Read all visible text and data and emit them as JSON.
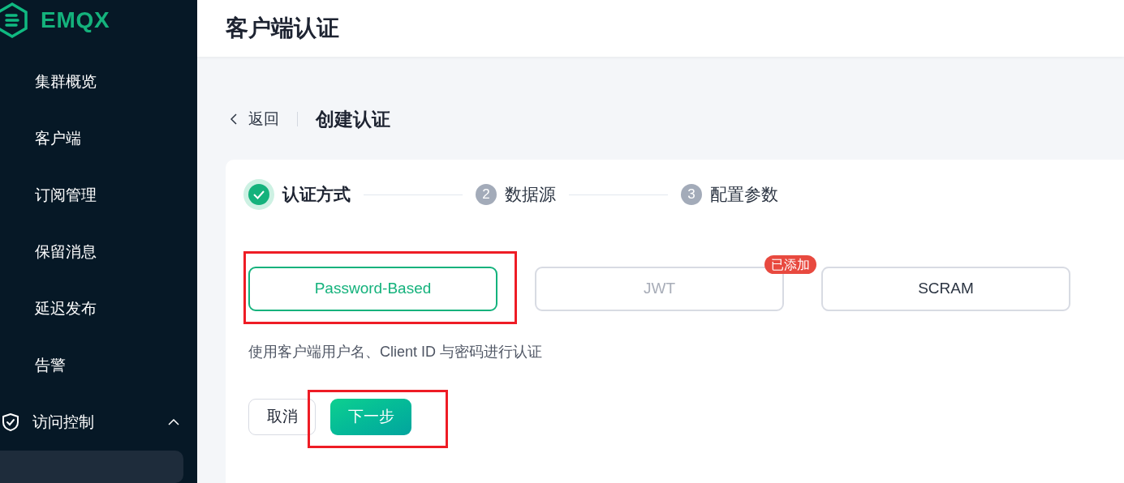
{
  "brand": {
    "name": "EMQX"
  },
  "sidebar": {
    "items": [
      {
        "label": "集群概览",
        "selected": false
      },
      {
        "label": "客户端",
        "selected": false
      },
      {
        "label": "订阅管理",
        "selected": false
      },
      {
        "label": "保留消息",
        "selected": false
      },
      {
        "label": "延迟发布",
        "selected": false
      },
      {
        "label": "告警",
        "selected": false
      },
      {
        "label": "访问控制",
        "selected": false,
        "expanded": true,
        "kind": "group"
      }
    ]
  },
  "header": {
    "title": "客户端认证"
  },
  "breadcrumb": {
    "back": "返回",
    "title": "创建认证"
  },
  "steps": [
    {
      "label": "认证方式",
      "done": true
    },
    {
      "label": "数据源",
      "number": "2",
      "done": false
    },
    {
      "label": "配置参数",
      "number": "3",
      "done": false
    }
  ],
  "options": [
    {
      "label": "Password-Based",
      "selected": true,
      "disabled": false,
      "highlighted": true
    },
    {
      "label": "JWT",
      "selected": false,
      "disabled": true,
      "badge": "已添加"
    },
    {
      "label": "SCRAM",
      "selected": false,
      "disabled": false
    }
  ],
  "description": "使用客户端用户名、Client ID 与密码进行认证",
  "buttons": [
    {
      "label": "取消",
      "kind": "secondary"
    },
    {
      "label": "下一步",
      "kind": "primary",
      "highlighted": true
    }
  ]
}
